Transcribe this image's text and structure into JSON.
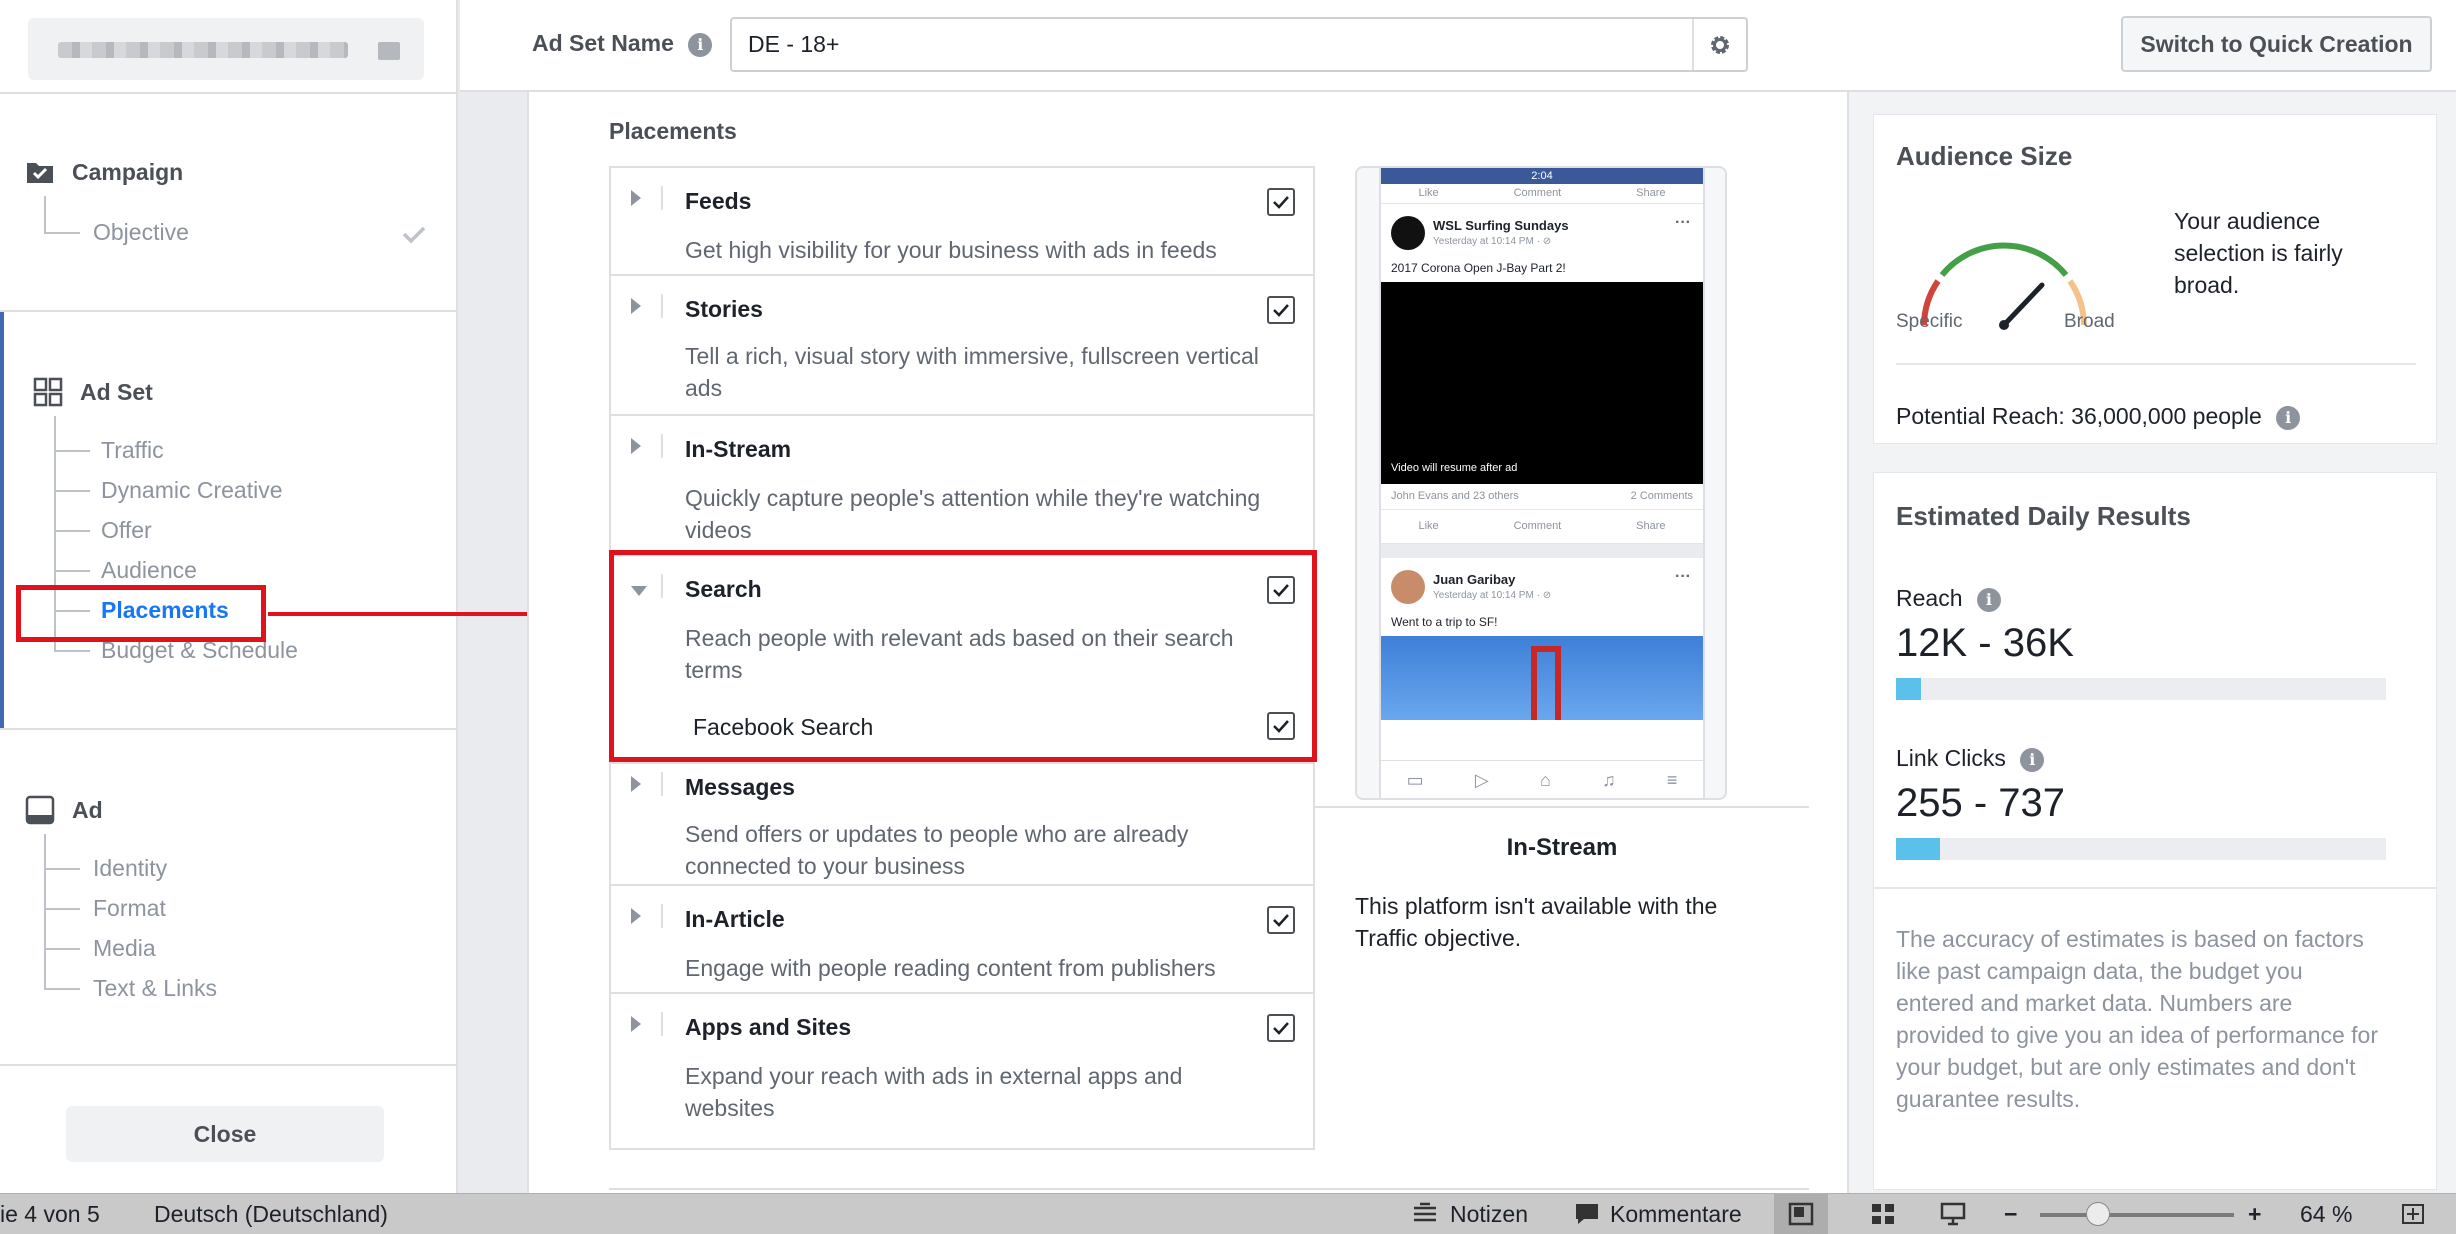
{
  "sidebar": {
    "campaign": {
      "title": "Campaign",
      "items": [
        "Objective"
      ]
    },
    "adset": {
      "title": "Ad Set",
      "items": [
        "Traffic",
        "Dynamic Creative",
        "Offer",
        "Audience",
        "Placements",
        "Budget & Schedule"
      ]
    },
    "ad": {
      "title": "Ad",
      "items": [
        "Identity",
        "Format",
        "Media",
        "Text & Links"
      ]
    },
    "close_label": "Close"
  },
  "topbar": {
    "adset_name_label": "Ad Set Name",
    "adset_name_value": "DE - 18+",
    "quick_creation_label": "Switch to Quick Creation"
  },
  "placements": {
    "title": "Placements",
    "rows": [
      {
        "title": "Feeds",
        "desc": "Get high visibility for your business with ads in feeds",
        "checked": true
      },
      {
        "title": "Stories",
        "desc": "Tell a rich, visual story with immersive, fullscreen vertical ads",
        "checked": true
      },
      {
        "title": "In-Stream",
        "desc": "Quickly capture people's attention while they're watching videos",
        "checked": false
      },
      {
        "title": "Search",
        "desc": "Reach people with relevant ads based on their search terms",
        "checked": true,
        "sub": "Facebook Search"
      },
      {
        "title": "Messages",
        "desc": "Send offers or updates to people who are already connected to your business",
        "checked": false
      },
      {
        "title": "In-Article",
        "desc": "Engage with people reading content from publishers",
        "checked": true
      },
      {
        "title": "Apps and Sites",
        "desc": "Expand your reach with ads in external apps and websites",
        "checked": true
      }
    ]
  },
  "preview": {
    "status_time": "2:04",
    "actions": [
      "Like",
      "Comment",
      "Share"
    ],
    "post1": {
      "name": "WSL Surfing Sundays",
      "time": "Yesterday at 10:14 PM · ⊘",
      "text": "2017 Corona Open J-Bay Part 2!",
      "video_caption": "Video will resume after ad",
      "reactions": "John Evans and 23 others",
      "comments": "2 Comments"
    },
    "post2": {
      "name": "Juan Garibay",
      "time": "Yesterday at 10:14 PM · ⊘",
      "text": "Went to a trip to SF!"
    },
    "title": "In-Stream",
    "desc": "This platform isn't available with the Traffic objective."
  },
  "audience": {
    "title": "Audience Size",
    "gauge_text": "Your audience selection is fairly broad.",
    "specific_label": "Specific",
    "broad_label": "Broad",
    "potential_reach_label": "Potential Reach:",
    "potential_reach_value": "36,000,000 people"
  },
  "estimates": {
    "title": "Estimated Daily Results",
    "reach_label": "Reach",
    "reach_value": "12K - 36K",
    "reach_fill": 0.05,
    "clicks_label": "Link Clicks",
    "clicks_value": "255 - 737",
    "clicks_fill": 0.09,
    "accuracy_text": "The accuracy of estimates is based on factors like past campaign data, the budget you entered and market data. Numbers are provided to give you an idea of performance for your budget, but are only estimates and don't guarantee results."
  },
  "statusbar": {
    "slide": "ie 4 von 5",
    "language": "Deutsch (Deutschland)",
    "notes": "Notizen",
    "comments": "Kommentare",
    "zoom": "64 %"
  },
  "colors": {
    "highlight": "#e0121b",
    "link": "#1877f2",
    "bar_fill": "#5bc0eb"
  }
}
